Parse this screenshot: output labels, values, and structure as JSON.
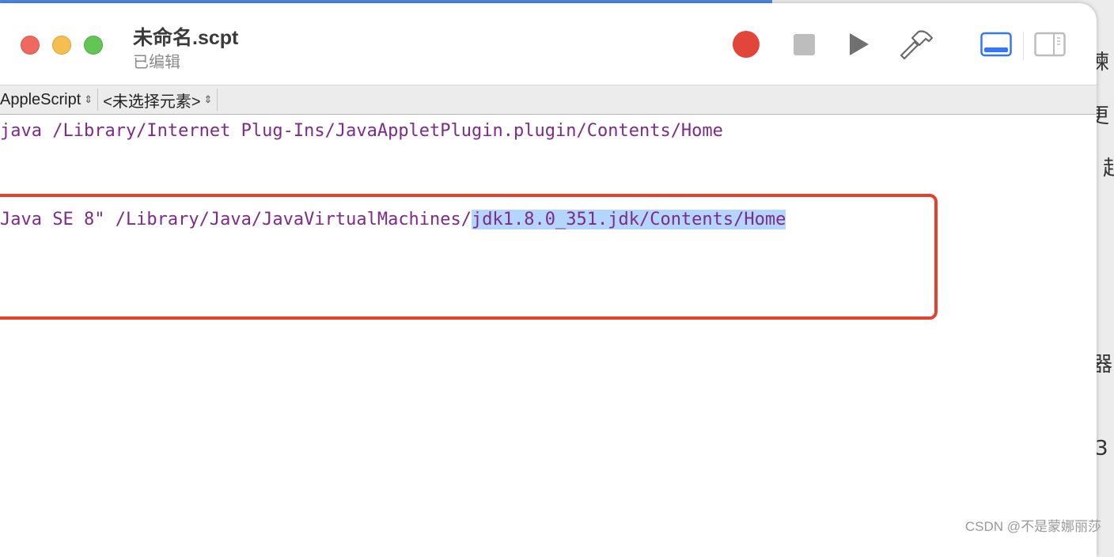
{
  "background": {
    "fragments": [
      "谏",
      "更",
      "起",
      "器",
      "3"
    ]
  },
  "window": {
    "title": "未命名.scpt",
    "subtitle": "已编辑"
  },
  "toolbar": {
    "record": "record-icon",
    "stop": "stop-icon",
    "run": "play-icon",
    "compile": "hammer-icon",
    "accent": "#3478f6"
  },
  "navbar": {
    "language": "AppleScript",
    "element": "<未选择元素>"
  },
  "code": {
    "line1": "java /Library/Internet Plug-Ins/JavaAppletPlugin.plugin/Contents/Home",
    "line2_prefix": "Java SE 8\" /Library/Java/JavaVirtualMachines/",
    "line2_selected": "jdk1.8.0_351.jdk/Contents/Home"
  },
  "watermark": "CSDN @不是蒙娜丽莎"
}
